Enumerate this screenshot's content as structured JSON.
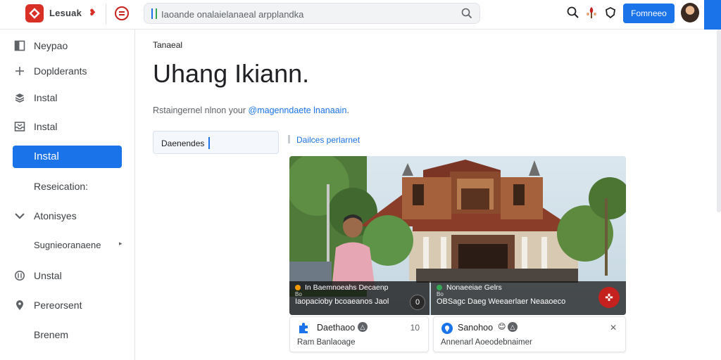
{
  "header": {
    "app_name": "Lesuak",
    "search_placeholder": "Iaoande onalaielanaeal arpplandka",
    "primary_button": "Fomneeo",
    "icons": [
      "search-icon",
      "pin-icon",
      "shield-icon"
    ]
  },
  "sidebar": {
    "items": [
      {
        "label": "Neypao",
        "icon": "window-icon"
      },
      {
        "label": "Doplderants",
        "icon": "plus-icon"
      },
      {
        "label": "Instal",
        "icon": "layers-icon"
      },
      {
        "label": "Instal",
        "icon": "inbox-icon"
      },
      {
        "label": "Instal",
        "icon": "",
        "active": true
      },
      {
        "label": "Reseication:",
        "icon": ""
      },
      {
        "label": "Atonisyes",
        "icon": "chevron-down-icon"
      },
      {
        "label": "Sugnieoranaene",
        "icon": "",
        "chevron": "▸"
      },
      {
        "label": "Unstal",
        "icon": "circle-icon"
      },
      {
        "label": "Pereorsent",
        "icon": "location-icon"
      },
      {
        "label": "Brenem",
        "icon": ""
      }
    ]
  },
  "main": {
    "breadcrumb": "Tanaeal",
    "title": "Uhang Ikiann.",
    "subtitle_text": "Rstaingernel nlnon your",
    "subtitle_link": "@magenndaete lnanaain",
    "field_value": "Daenendes",
    "link": "Dailces perlarnet"
  },
  "photo": {
    "caption_left_top": "In  Baemnoeahs Decaenp",
    "caption_left_sub": "Bo",
    "caption_left_bottom": "Iaopacioby bcoaeanos Jaol",
    "caption_left_badge": "0",
    "caption_right_top": "Nonaeeiae Gelrs",
    "caption_right_sub": "Bo",
    "caption_right_bottom": "OBSagc Daeg Weeaerlaer Neaaoeco"
  },
  "cards": [
    {
      "title": "Daethaoo",
      "sub": "Ram Banlaoage",
      "icon": "puzzle-icon",
      "meta": "10"
    },
    {
      "title": "Sanohoo",
      "sub": "Annenarl Aoeodebnaimer",
      "icon": "location-icon",
      "meta": "✕"
    }
  ]
}
